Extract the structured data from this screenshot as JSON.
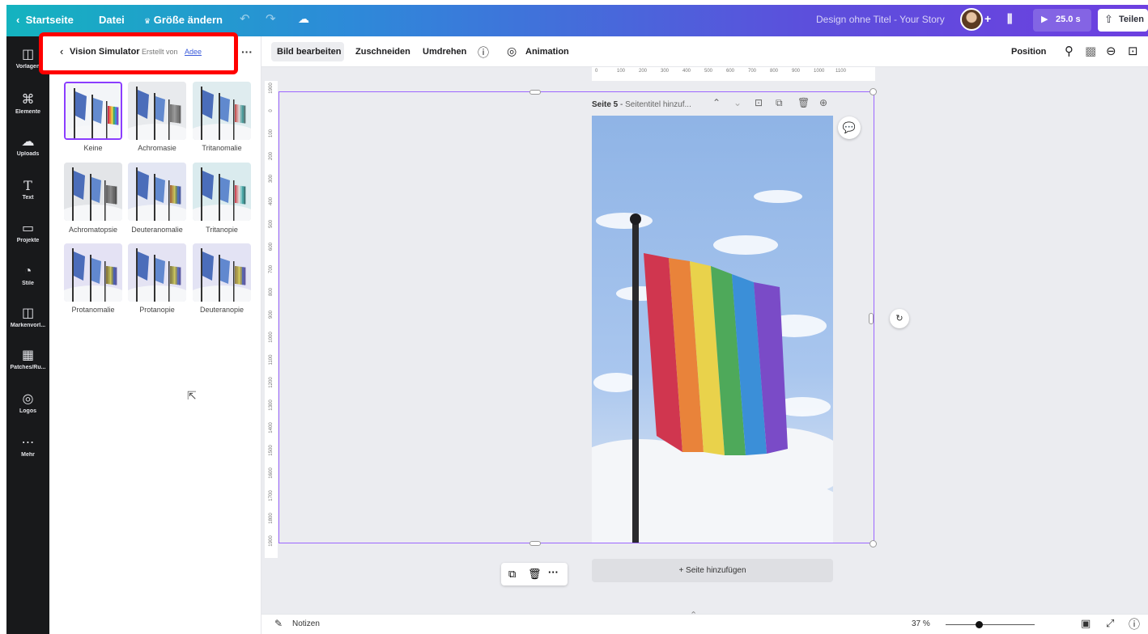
{
  "topbar": {
    "home": "Startseite",
    "file": "Datei",
    "resize": "Größe ändern",
    "design_title": "Design ohne Titel - Your Story",
    "play_time": "25.0 s",
    "share": "Teilen",
    "plus": "+"
  },
  "rail": [
    {
      "label": "Vorlagen",
      "icon": "template-icon"
    },
    {
      "label": "Elemente",
      "icon": "elements-icon"
    },
    {
      "label": "Uploads",
      "icon": "upload-icon"
    },
    {
      "label": "Text",
      "icon": "text-icon"
    },
    {
      "label": "Projekte",
      "icon": "folder-icon"
    },
    {
      "label": "Stile",
      "icon": "palette-icon"
    },
    {
      "label": "Markenvorl...",
      "icon": "brand-icon"
    },
    {
      "label": "Patches/Ru...",
      "icon": "patches-icon"
    },
    {
      "label": "Logos",
      "icon": "logos-icon"
    },
    {
      "label": "Mehr",
      "icon": "more-icon"
    }
  ],
  "panel": {
    "app_name": "Vision Simulator",
    "created_by": "Erstellt von",
    "author": "Adee",
    "filters": [
      "Keine",
      "Achromasie",
      "Tritanomalie",
      "Achromatopsie",
      "Deuteranomalie",
      "Tritanopie",
      "Protanomalie",
      "Protanopie",
      "Deuteranopie"
    ]
  },
  "toolbar": {
    "edit_image": "Bild bearbeiten",
    "crop": "Zuschneiden",
    "flip": "Umdrehen",
    "animation": "Animation",
    "position": "Position"
  },
  "canvas": {
    "page_label": "Seite 5",
    "page_title_placeholder": "Seitentitel hinzuf...",
    "add_page": "+ Seite hinzufügen",
    "ruler_top": [
      "0",
      "100",
      "200",
      "300",
      "400",
      "500",
      "600",
      "700",
      "800",
      "900",
      "1000",
      "1100"
    ],
    "ruler_left": [
      "1900",
      "0",
      "100",
      "200",
      "300",
      "400",
      "500",
      "600",
      "700",
      "800",
      "900",
      "1000",
      "1100",
      "1200",
      "1300",
      "1400",
      "1500",
      "1600",
      "1700",
      "1800",
      "1900"
    ]
  },
  "bottombar": {
    "notes": "Notizen",
    "zoom": "37 %",
    "zoom_value": 0.37
  },
  "colors": {
    "accent": "#8b3dff",
    "highlight": "#ff0000",
    "rail_bg": "#18191b"
  }
}
